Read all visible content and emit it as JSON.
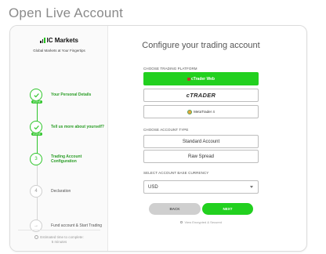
{
  "page": {
    "title": "Open Live Account"
  },
  "brand": {
    "name": "IC Markets",
    "tagline": "Global Markets at Your Fingertips"
  },
  "steps": [
    {
      "label": "Your Personal Details",
      "status": "done",
      "badge": "DONE",
      "number": ""
    },
    {
      "label": "Tell us more about yourself?",
      "status": "done",
      "badge": "DONE",
      "number": ""
    },
    {
      "label": "Trading Account Configuration",
      "status": "active",
      "badge": "",
      "number": "3"
    },
    {
      "label": "Declaration",
      "status": "pending",
      "badge": "",
      "number": "4"
    },
    {
      "label": "Fund account & Start Trading",
      "status": "pending",
      "badge": "",
      "number": "→"
    }
  ],
  "estimate": {
    "line1": "Estimated time to complete:",
    "line2": "5 minutes"
  },
  "main": {
    "headline": "Configure your trading account",
    "platform_label": "CHOOSE TRADING PLATFORM",
    "platforms": [
      {
        "name": "cTrader Web",
        "selected": true
      },
      {
        "name": "cTRADER",
        "selected": false
      },
      {
        "name": "MetaTrader 4",
        "selected": false
      }
    ],
    "account_type_label": "CHOOSE ACCOUNT TYPE",
    "account_types": [
      "Standard Account",
      "Raw Spread"
    ],
    "currency_label": "SELECT ACCOUNT BASE CURRENCY",
    "currency_value": "USD",
    "back_label": "BACK",
    "next_label": "NEXT",
    "secured_text": "View Encrypted & Secured"
  },
  "colors": {
    "accent": "#22d01f",
    "accent_dark": "#2a9d26",
    "muted": "#8a8a8a"
  }
}
